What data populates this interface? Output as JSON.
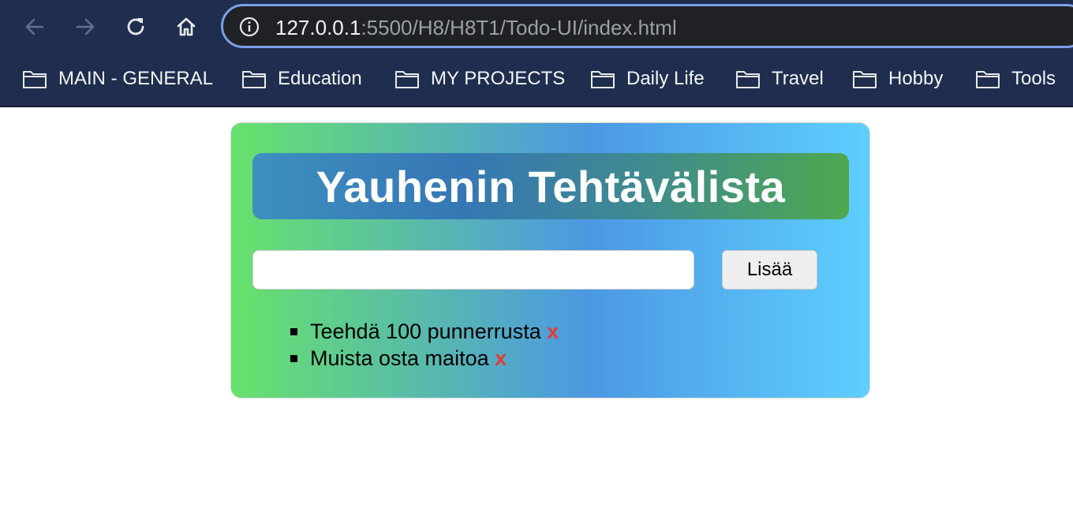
{
  "browser": {
    "url_host": "127.0.0.1",
    "url_path": ":5500/H8/H8T1/Todo-UI/index.html",
    "nav_icons": [
      "back-arrow-icon",
      "forward-arrow-icon",
      "reload-icon",
      "home-icon"
    ],
    "bookmarks": [
      {
        "label": "MAIN - GENERAL",
        "icon": "folder-icon"
      },
      {
        "label": "Education",
        "icon": "folder-icon"
      },
      {
        "label": "MY PROJECTS",
        "icon": "folder-icon"
      },
      {
        "label": "Daily Life",
        "icon": "folder-icon"
      },
      {
        "label": "Travel",
        "icon": "folder-icon"
      },
      {
        "label": "Hobby",
        "icon": "folder-icon"
      },
      {
        "label": "Tools",
        "icon": "folder-icon"
      }
    ]
  },
  "app": {
    "title": "Yauhenin Tehtävälista",
    "input_value": "",
    "add_label": "Lisää",
    "tasks": [
      {
        "text": "Teehdä 100 punnerrusta",
        "delete_label": "x"
      },
      {
        "text": "Muista osta maitoa",
        "delete_label": "x"
      }
    ]
  },
  "colors": {
    "chrome_bg": "#1f2e4e",
    "urlbar_bg": "#202124",
    "urlbar_border": "#7c9ee6",
    "card_gradient": [
      "#67e26b",
      "#4c98e3",
      "#5ecffe"
    ],
    "title_gradient": [
      "#3e8fc0",
      "#3577b4",
      "#4ea84f"
    ],
    "delete_color": "#e53935"
  }
}
